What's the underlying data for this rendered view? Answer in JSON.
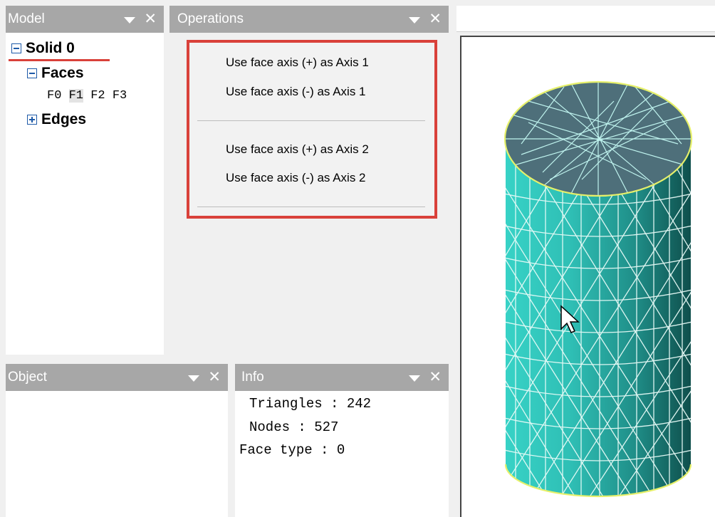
{
  "model_panel": {
    "title": "Model",
    "solid_label": "Solid 0",
    "faces_label": "Faces",
    "face_items": [
      "F0",
      "F1",
      "F2",
      "F3"
    ],
    "edges_label": "Edges"
  },
  "operations_panel": {
    "title": "Operations",
    "menu_items": [
      "Use face axis (+) as Axis 1",
      "Use face axis (-) as Axis 1",
      "Use face axis (+) as Axis 2",
      "Use face axis (-) as Axis 2"
    ]
  },
  "object_panel": {
    "title": "Object"
  },
  "info_panel": {
    "title": "Info",
    "triangles_line": "Triangles : 242",
    "nodes_line": "Nodes : 527",
    "face_type_line": "Face type : 0"
  },
  "colors": {
    "title_bar": "#a7a7a7",
    "highlight_red": "#d9413a",
    "mesh_cyan": "#2fbfb5",
    "mesh_top": "#4e6f7a",
    "edge_yellow": "#e6f06a"
  }
}
